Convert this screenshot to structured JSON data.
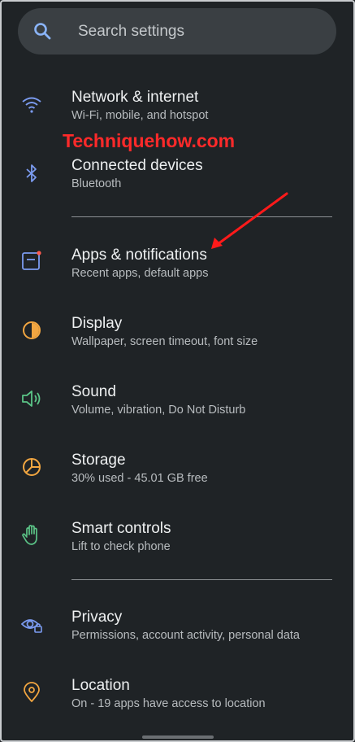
{
  "search": {
    "placeholder": "Search settings",
    "icon": "search-icon"
  },
  "watermark": "Techniquehow.com",
  "colors": {
    "background": "#1f2326",
    "search_icon": "#8ab4f8",
    "annotation_arrow": "#ff1a1a"
  },
  "settings_items": [
    {
      "title": "Network & internet",
      "subtitle": "Wi-Fi, mobile, and hotspot",
      "icon": "wifi-icon",
      "icon_color": "#7b9bf0"
    },
    {
      "title": "Connected devices",
      "subtitle": "Bluetooth",
      "icon": "bluetooth-icon",
      "icon_color": "#7b9bf0"
    },
    {
      "title": "Apps & notifications",
      "subtitle": "Recent apps, default apps",
      "icon": "apps-icon",
      "icon_color": "#7b9bf0"
    },
    {
      "title": "Display",
      "subtitle": "Wallpaper, screen timeout, font size",
      "icon": "display-icon",
      "icon_color": "#f2a641"
    },
    {
      "title": "Sound",
      "subtitle": "Volume, vibration, Do Not Disturb",
      "icon": "speaker-icon",
      "icon_color": "#5bc487"
    },
    {
      "title": "Storage",
      "subtitle": "30% used - 45.01 GB free",
      "icon": "storage-icon",
      "icon_color": "#f2a641"
    },
    {
      "title": "Smart controls",
      "subtitle": "Lift to check phone",
      "icon": "hand-icon",
      "icon_color": "#5bc487"
    },
    {
      "title": "Privacy",
      "subtitle": "Permissions, account activity, personal data",
      "icon": "eye-lock-icon",
      "icon_color": "#7b9bf0"
    },
    {
      "title": "Location",
      "subtitle": "On - 19 apps have access to location",
      "icon": "location-pin-icon",
      "icon_color": "#f2a641"
    }
  ]
}
